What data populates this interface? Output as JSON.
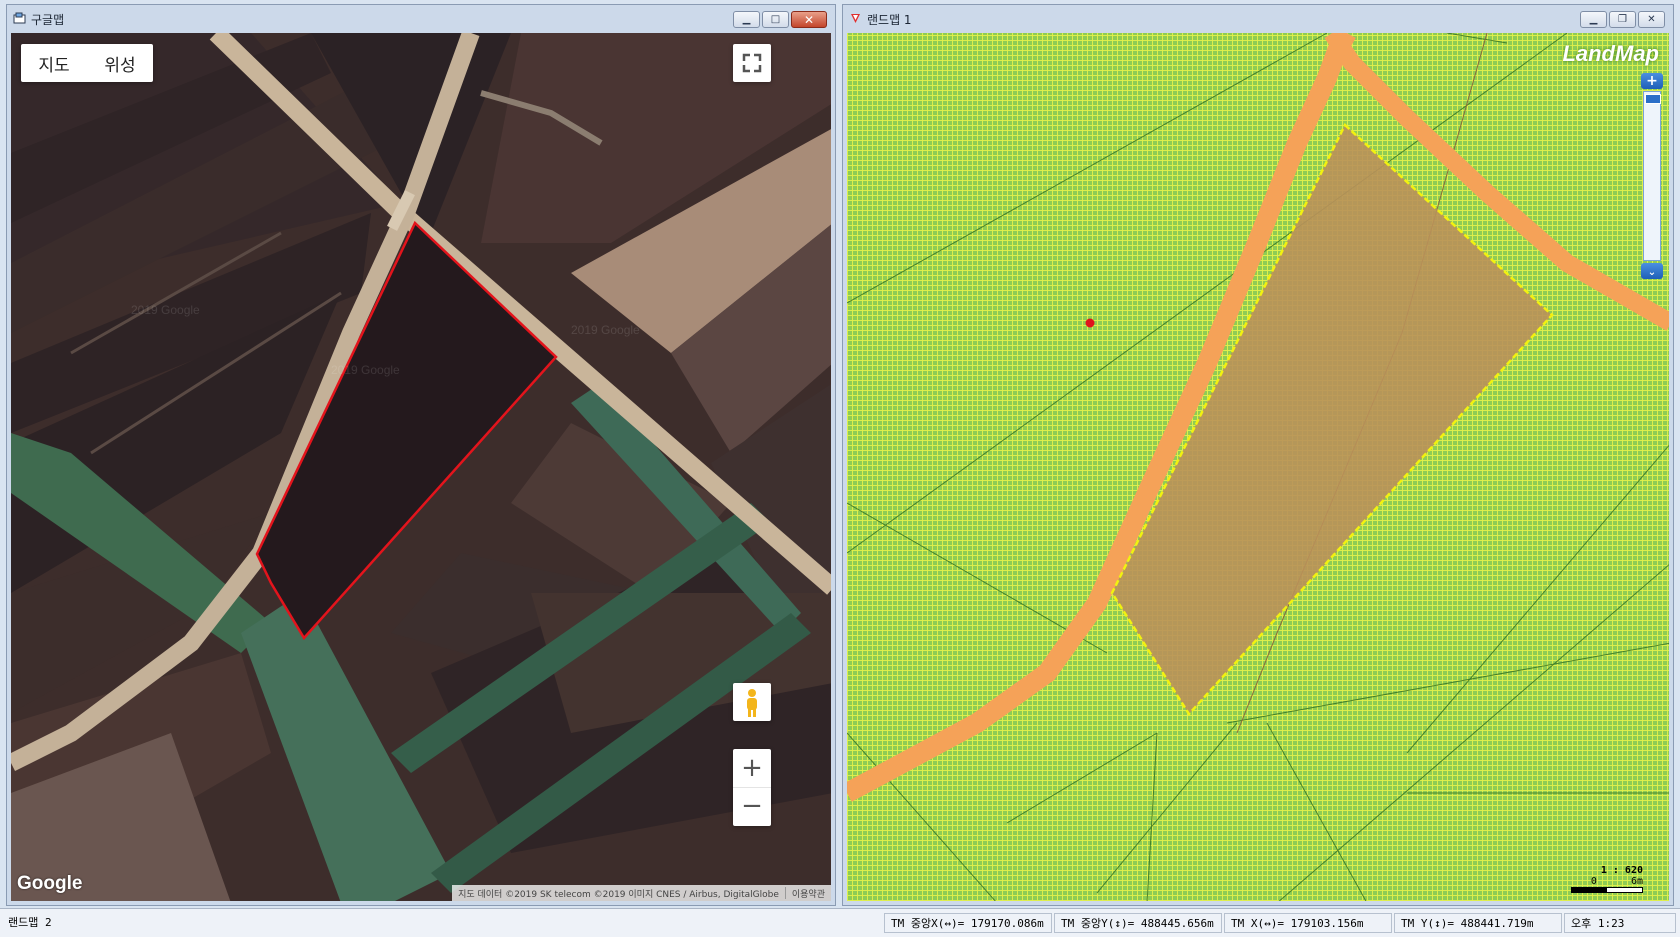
{
  "left_window": {
    "title": "구글맵",
    "map_type": {
      "map_label": "지도",
      "satellite_label": "위성"
    },
    "logo": "Google",
    "watermark": "2019 Google",
    "attribution": "지도 데이터 ©2019 SK telecom ©2019 이미지 CNES / Airbus, DigitalGlobe",
    "terms_label": "이용약관",
    "zoom_in_label": "+",
    "zoom_out_label": "−"
  },
  "right_window": {
    "title": "랜드맵 1",
    "logo": "LandMap",
    "zoom_in_label": "+",
    "scale_ratio": "1 : 620",
    "scale_start": "0",
    "scale_end": "6m"
  },
  "status_bar": {
    "panel_name": "랜드맵 2",
    "center_x": "TM 중앙X(↔)= 179170.086m",
    "center_y": "TM 중앙Y(↕)= 488445.656m",
    "tm_x": "TM X(↔)= 179103.156m",
    "tm_y": "TM Y(↕)= 488441.719m",
    "time": "오후 1:23"
  },
  "colors": {
    "parcel_outline": "#e3141c",
    "road": "#f5a258",
    "landmap_field": "#8fcc54",
    "selected_parcel": "#b9915a",
    "selected_outline": "#f2f20f"
  }
}
